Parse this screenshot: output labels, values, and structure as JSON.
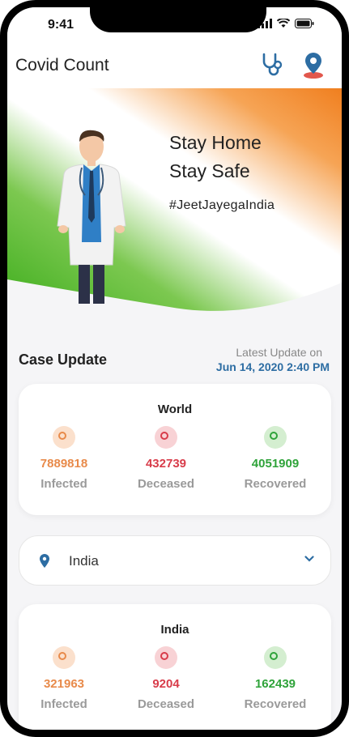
{
  "status_bar": {
    "time": "9:41"
  },
  "app_bar": {
    "title": "Covid Count",
    "icons": [
      "stethoscope-icon",
      "location-pin-icon"
    ]
  },
  "hero": {
    "line1": "Stay Home",
    "line2": "Stay Safe",
    "hashtag": "#JeetJayegaIndia"
  },
  "case_update": {
    "title": "Case Update",
    "latest_label": "Latest Update on",
    "latest_date": "Jun 14, 2020 2:40 PM"
  },
  "world": {
    "title": "World",
    "infected": {
      "value": "7889818",
      "label": "Infected"
    },
    "deceased": {
      "value": "432739",
      "label": "Deceased"
    },
    "recovered": {
      "value": "4051909",
      "label": "Recovered"
    }
  },
  "country_select": {
    "selected": "India"
  },
  "india": {
    "title": "India",
    "infected": {
      "value": "321963",
      "label": "Infected"
    },
    "deceased": {
      "value": "9204",
      "label": "Deceased"
    },
    "recovered": {
      "value": "162439",
      "label": "Recovered"
    }
  },
  "colors": {
    "infected": "#e88a4a",
    "deceased": "#d83c4a",
    "recovered": "#2fa33a",
    "accent": "#2d6da3"
  }
}
